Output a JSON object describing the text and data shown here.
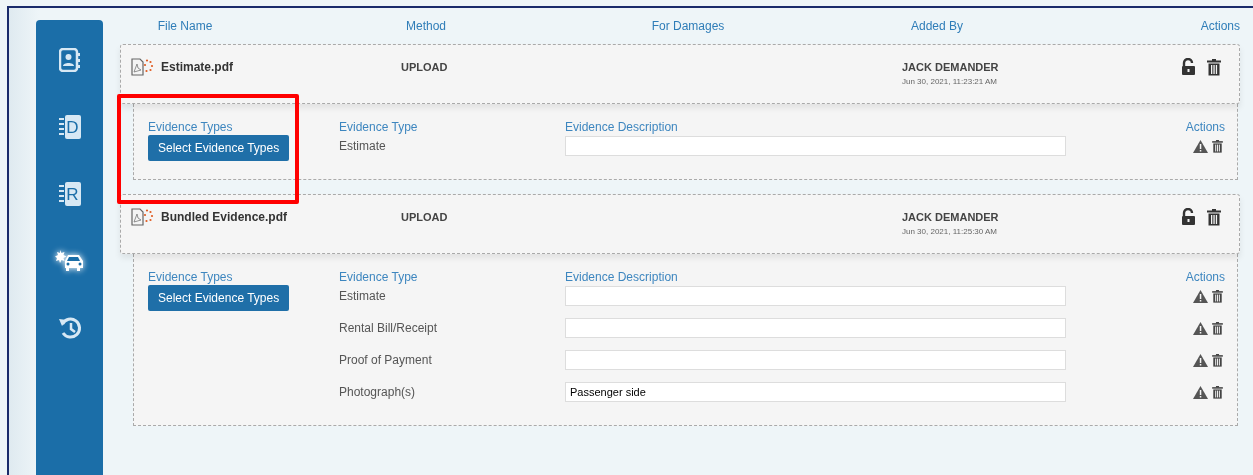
{
  "sidebar": {
    "items": [
      {
        "kind": "contacts",
        "selected": false
      },
      {
        "kind": "letter",
        "letter": "D",
        "selected": false
      },
      {
        "kind": "letter",
        "letter": "R",
        "selected": false
      },
      {
        "kind": "crash",
        "selected": true
      },
      {
        "kind": "history",
        "selected": false
      }
    ]
  },
  "table": {
    "columns": [
      "File Name",
      "Method",
      "For Damages",
      "Added By",
      "Actions"
    ],
    "files": [
      {
        "name": "Estimate.pdf",
        "method": "UPLOAD",
        "added_by": "JACK DEMANDER",
        "added_at": "Jun 30, 2021, 11:23:21 AM",
        "highlighted": true,
        "evidence": {
          "types_label": "Evidence Types",
          "button": "Select Evidence Types",
          "type_label": "Evidence Type",
          "description_label": "Evidence Description",
          "actions_label": "Actions",
          "items": [
            {
              "type": "Estimate"
            }
          ]
        }
      },
      {
        "name": "Bundled Evidence.pdf",
        "method": "UPLOAD",
        "added_by": "JACK DEMANDER",
        "added_at": "Jun 30, 2021, 11:25:30 AM",
        "highlighted": false,
        "evidence": {
          "types_label": "Evidence Types",
          "button": "Select Evidence Types",
          "type_label": "Evidence Type",
          "description_label": "Evidence Description",
          "actions_label": "Actions",
          "items": [
            {
              "type": "Estimate"
            },
            {
              "type": "Rental Bill/Receipt"
            },
            {
              "type": "Proof of Payment"
            },
            {
              "type": "Photograph(s)",
              "description": "Passenger side"
            }
          ]
        }
      }
    ]
  }
}
